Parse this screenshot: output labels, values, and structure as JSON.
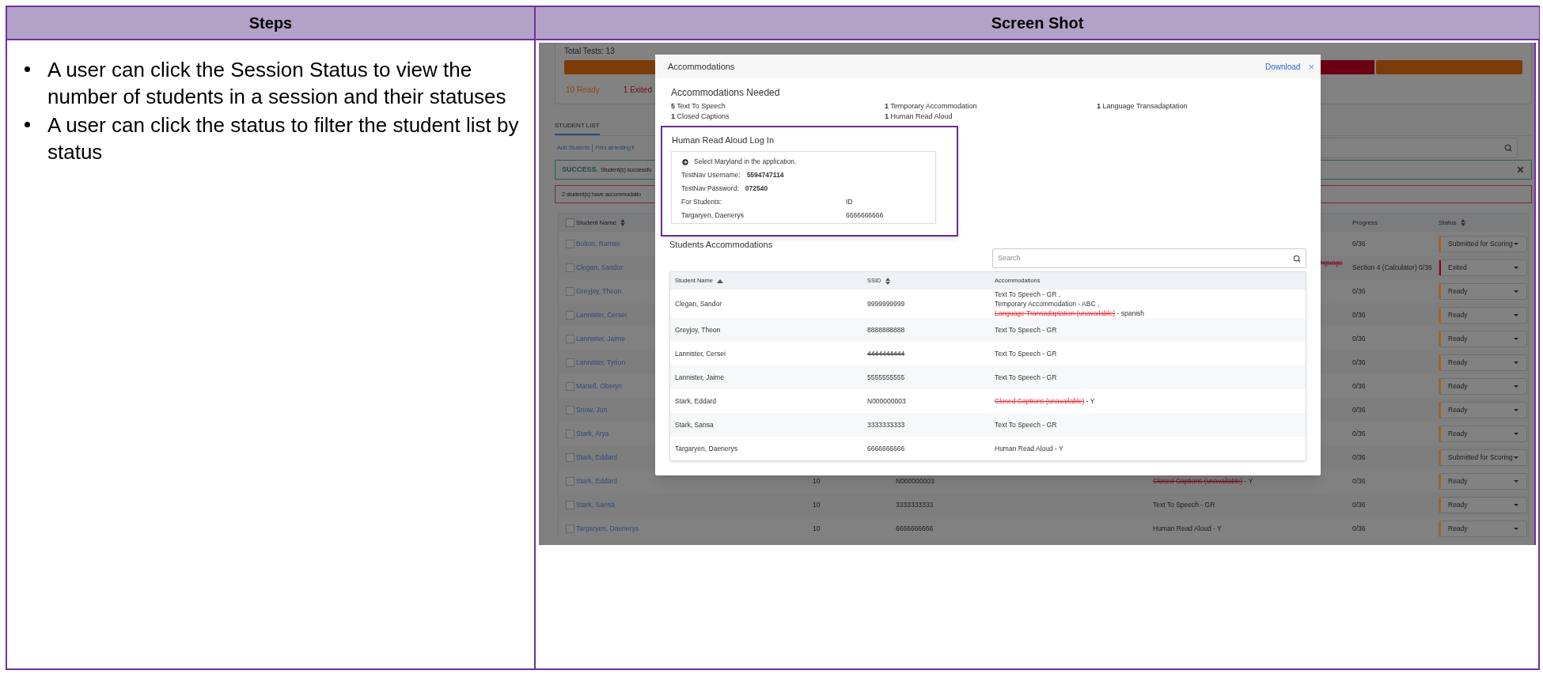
{
  "document": {
    "columns": [
      "Steps",
      "Screen Shot"
    ]
  },
  "steps": [
    "A user can click the Session Status to view the number of students in a session and their statuses",
    "A user can click the status to filter the student list by status"
  ],
  "screenshot": {
    "summary": {
      "total": "Total Tests: 13",
      "counts": [
        {
          "label": "10 Ready",
          "color": "#8c4a14"
        },
        {
          "label": "1 Exited",
          "color": "#7a0a1e"
        }
      ]
    },
    "tab": {
      "label": "STUDENT LIST",
      "selected": true
    },
    "links": [
      "Add Students",
      "Print all testing ti"
    ],
    "success": {
      "title": "SUCCESS.",
      "message": "Student(s) successfu"
    },
    "alert": "2 student(s) have accommodatio",
    "table": {
      "select_all_checked": false,
      "columns": [
        {
          "label": "Student Name",
          "sortable": true
        },
        {
          "label": "Progress",
          "sortable": false
        },
        {
          "label": "Status",
          "sortable": true
        }
      ],
      "rows": [
        {
          "name": "Bolton, Ramse",
          "checked": false,
          "progress": "0/36",
          "status": {
            "label": "Submitted for Scoring",
            "color": "#b35f0f"
          }
        },
        {
          "name": "Clegan, Sandor",
          "checked": false,
          "fragment": "nguage",
          "progress": "Section 4 (Calculator) 0/36",
          "status": {
            "label": "Exited",
            "color": "#8a0018"
          }
        },
        {
          "name": "Greyjoy, Theon",
          "checked": false,
          "progress": "0/36",
          "status": {
            "label": "Ready",
            "color": "#b35f0f"
          }
        },
        {
          "name": "Lannister, Cersei",
          "checked": false,
          "progress": "0/36",
          "status": {
            "label": "Ready",
            "color": "#b35f0f"
          }
        },
        {
          "name": "Lannister, Jaime",
          "checked": false,
          "progress": "0/36",
          "status": {
            "label": "Ready",
            "color": "#b35f0f"
          }
        },
        {
          "name": "Lannister, Tyrion",
          "checked": false,
          "progress": "0/36",
          "status": {
            "label": "Ready",
            "color": "#b35f0f"
          }
        },
        {
          "name": "Martell, Oberyn",
          "checked": false,
          "progress": "0/36",
          "status": {
            "label": "Ready",
            "color": "#b35f0f"
          }
        },
        {
          "name": "Snow, Jon",
          "checked": false,
          "progress": "0/36",
          "status": {
            "label": "Ready",
            "color": "#b35f0f"
          }
        },
        {
          "name": "Stark, Arya",
          "checked": false,
          "progress": "0/36",
          "status": {
            "label": "Ready",
            "color": "#b35f0f"
          }
        },
        {
          "name": "Stark, Eddard",
          "checked": false,
          "progress": "0/36",
          "status": {
            "label": "Submitted for Scoring",
            "color": "#b35f0f"
          }
        },
        {
          "name": "Stark, Eddard",
          "checked": false,
          "grade": "10",
          "ssid": "N000000003",
          "accommodation": {
            "text": "Closed Captions (unavailable)",
            "unavailable": true,
            "suffix": " - Y"
          },
          "progress": "0/36",
          "status": {
            "label": "Ready",
            "color": "#b35f0f"
          }
        },
        {
          "name": "Stark, Sansa",
          "checked": false,
          "grade": "10",
          "ssid": "3333333333",
          "accommodation": {
            "text": "Text To Speech - GR",
            "unavailable": false
          },
          "progress": "0/36",
          "status": {
            "label": "Ready",
            "color": "#b35f0f"
          }
        },
        {
          "name": "Targaryen, Daenerys",
          "checked": false,
          "grade": "10",
          "ssid": "6666666666",
          "accommodation": {
            "text": "Human Read Aloud - Y",
            "unavailable": false
          },
          "progress": "0/36",
          "status": {
            "label": "Ready",
            "color": "#b35f0f"
          }
        }
      ]
    },
    "modal": {
      "title": "Accommodations",
      "download": "Download",
      "close": "×",
      "needed_title": "Accommodations Needed",
      "needed": [
        "**5** Text To Speech",
        "**1** Temporary Accommodation",
        "**1** Language Transadaptation",
        "**1** Closed Captions",
        "**1** Human Read Aloud"
      ],
      "login": {
        "title": "Human Read Aloud Log In",
        "highlighted": true,
        "instruction": "Select Maryland in the application.",
        "credentials": [
          {
            "label": "TestNav Username:",
            "value": "5594747114"
          },
          {
            "label": "TestNav Password:",
            "value": "072540"
          }
        ],
        "students_header": [
          "For Students:",
          "ID"
        ],
        "students": [
          {
            "name": "Targaryen, Daenerys",
            "id": "6666666666"
          }
        ]
      },
      "students_title": "Students Accommodations",
      "search": {
        "placeholder": "Search"
      },
      "table": {
        "columns": [
          {
            "label": "Student Name",
            "sortable": true,
            "sorted": true
          },
          {
            "label": "SSID",
            "sortable": true,
            "sorted": false
          },
          {
            "label": "Accommodations",
            "sortable": false
          }
        ],
        "rows": [
          {
            "name": "Clegan, Sandor",
            "ssid": "9999999999",
            "ssid_struck": false,
            "accommodations": [
              {
                "text": "Text To Speech - GR ,",
                "unavailable": false
              },
              {
                "text": "Temporary Accommodation - ABC ,",
                "unavailable": false
              },
              {
                "text": "Language Transadaptation (unavailable)",
                "unavailable": true,
                "suffix": " - spanish"
              }
            ]
          },
          {
            "name": "Greyjoy, Theon",
            "ssid": "8888888888",
            "ssid_struck": false,
            "accommodations": [
              {
                "text": "Text To Speech - GR",
                "unavailable": false
              }
            ]
          },
          {
            "name": "Lannister, Cersei",
            "ssid": "4444444444",
            "ssid_struck": true,
            "accommodations": [
              {
                "text": "Text To Speech - GR",
                "unavailable": false
              }
            ]
          },
          {
            "name": "Lannister, Jaime",
            "ssid": "5555555555",
            "ssid_struck": false,
            "accommodations": [
              {
                "text": "Text To Speech - GR",
                "unavailable": false
              }
            ]
          },
          {
            "name": "Stark, Eddard",
            "ssid": "N000000003",
            "ssid_struck": false,
            "accommodations": [
              {
                "text": "Closed Captions (unavailable)",
                "unavailable": true,
                "suffix": " - Y"
              }
            ]
          },
          {
            "name": "Stark, Sansa",
            "ssid": "3333333333",
            "ssid_struck": false,
            "accommodations": [
              {
                "text": "Text To Speech - GR",
                "unavailable": false
              }
            ]
          },
          {
            "name": "Targaryen, Daenerys",
            "ssid": "6666666666",
            "ssid_struck": false,
            "accommodations": [
              {
                "text": "Human Read Aloud - Y",
                "unavailable": false
              }
            ]
          }
        ]
      }
    }
  }
}
